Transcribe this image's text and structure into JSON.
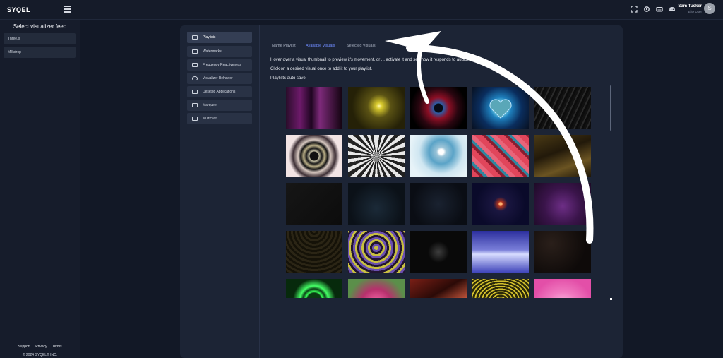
{
  "app": {
    "logo": "SYQEL",
    "user": {
      "name": "Sam Tucker",
      "role": "Elite User",
      "initial": "S"
    }
  },
  "sidebar": {
    "title": "Select visualizer feed",
    "items": [
      {
        "label": "Three.js"
      },
      {
        "label": "Milkdrop"
      }
    ],
    "footer": {
      "support": "Support",
      "privacy": "Privacy",
      "terms": "Terms",
      "copyright": "© 2024 SYQEL® INC."
    }
  },
  "settings_nav": {
    "items": [
      {
        "label": "Playlists",
        "icon": "playlist-icon"
      },
      {
        "label": "Watermarks",
        "icon": "watermark-icon"
      },
      {
        "label": "Frequency Reactiveness",
        "icon": "equalizer-icon"
      },
      {
        "label": "Visualizer Behavior",
        "icon": "flame-icon"
      },
      {
        "label": "Desktop Applications",
        "icon": "monitor-icon"
      },
      {
        "label": "Marquee",
        "icon": "marquee-icon"
      },
      {
        "label": "Multicast",
        "icon": "cast-icon"
      }
    ]
  },
  "tabs": {
    "items": [
      {
        "label": "Name Playlist"
      },
      {
        "label": "Available Visuals"
      },
      {
        "label": "Selected Visuals"
      }
    ],
    "active": "Available Visuals"
  },
  "info": {
    "line1": "Hover over a visual thumbnail to preview it's movement, or ... activate it and see how it responds to audio.",
    "line2": "Click on a desired visual once to add it to your playlist.",
    "line3": "Playlists auto save."
  },
  "thumbnails": {
    "rows": 5,
    "columns": 5,
    "count_visible": 25
  },
  "colors": {
    "background": "#121826",
    "panel": "#1c2435",
    "accent": "#6f8cff",
    "annotation_arrow": "#ffffff"
  }
}
